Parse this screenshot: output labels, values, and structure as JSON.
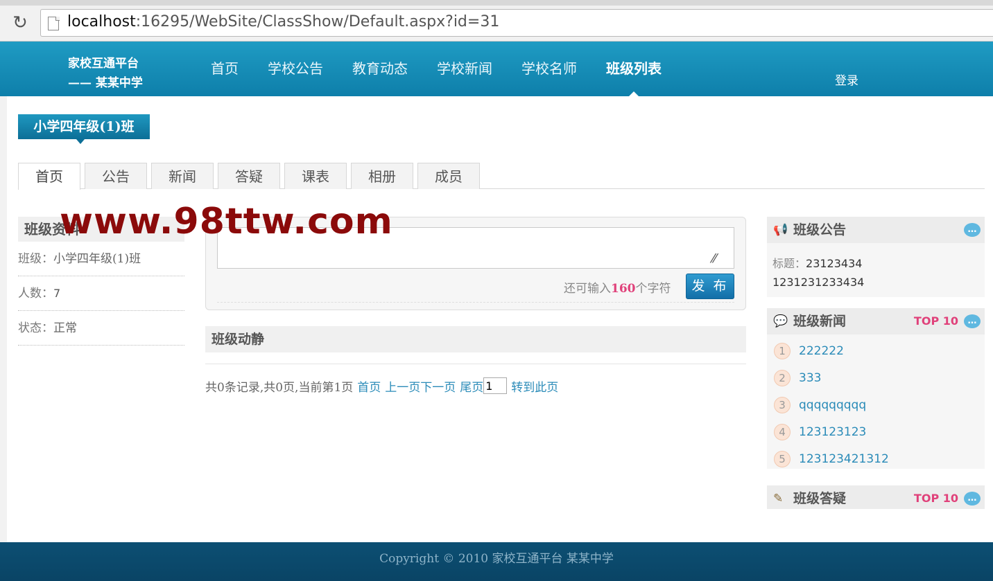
{
  "browser": {
    "url_host": "localhost",
    "url_rest": ":16295/WebSite/ClassShow/Default.aspx?id=31"
  },
  "header": {
    "logo_line1": "家校互通平台",
    "logo_line2": "—— 某某中学",
    "nav": [
      "首页",
      "学校公告",
      "教育动态",
      "学校新闻",
      "学校名师",
      "班级列表"
    ],
    "active_nav": "班级列表",
    "login": "登录"
  },
  "class_title": "小学四年级(1)班",
  "tabs": [
    "首页",
    "公告",
    "新闻",
    "答疑",
    "课表",
    "相册",
    "成员"
  ],
  "active_tab": "首页",
  "watermark": "www.98ttw.com",
  "class_info": {
    "title": "班级资料",
    "class_label": "班级：",
    "class_value": "小学四年级(1)班",
    "count_label": "人数：",
    "count_value": "7",
    "status_label": "状态：",
    "status_value": "正常"
  },
  "post": {
    "remaining_prefix": "还可输入",
    "remaining_count": "160",
    "remaining_suffix": "个字符",
    "publish": "发 布"
  },
  "feed": {
    "title": "班级动静",
    "pager_text": "共0条记录,共0页,当前第1页",
    "first": "首页",
    "prev": "上一页",
    "next": "下一页",
    "last": "尾页",
    "page_value": "1",
    "go": "转到此页"
  },
  "notice": {
    "title": "班级公告",
    "label": "标题：",
    "line1": "23123434",
    "line2": "1231231233434"
  },
  "news": {
    "title": "班级新闻",
    "badge": "TOP 10",
    "items": [
      {
        "rank": "1",
        "text": "222222"
      },
      {
        "rank": "2",
        "text": "333"
      },
      {
        "rank": "3",
        "text": "qqqqqqqqq"
      },
      {
        "rank": "4",
        "text": "123123123"
      },
      {
        "rank": "5",
        "text": "123123421312"
      }
    ]
  },
  "qa": {
    "title": "班级答疑",
    "badge": "TOP 10"
  },
  "footer": "Copyright © 2010 家校互通平台 某某中学",
  "colors": {
    "header_blue": "#1f9bc3",
    "footer_navy": "#0a4465",
    "accent_pink": "#e0417a",
    "link_blue": "#2a8bb8"
  }
}
